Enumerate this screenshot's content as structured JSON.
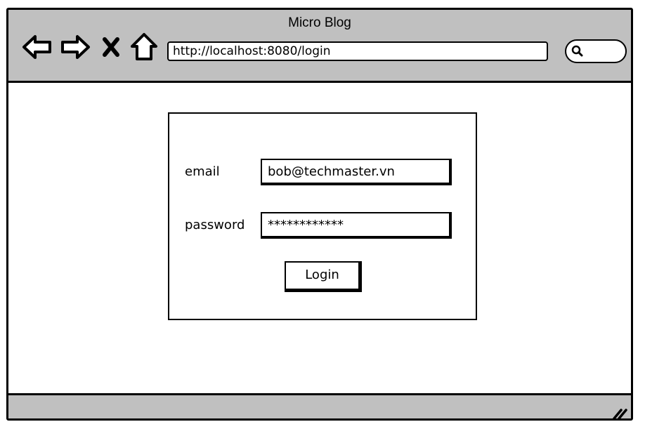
{
  "window": {
    "title": "Micro Blog"
  },
  "browser": {
    "url": "http://localhost:8080/login",
    "nav_icons": [
      "back-arrow-icon",
      "forward-arrow-icon",
      "close-x-icon",
      "home-icon"
    ],
    "search_icon": "search-icon"
  },
  "login_form": {
    "email_label": "email",
    "email_value": "bob@techmaster.vn",
    "password_label": "password",
    "password_value": "************",
    "login_button_label": "Login"
  },
  "colors": {
    "chrome": "#c0c0c0",
    "border": "#000000",
    "background": "#ffffff"
  }
}
